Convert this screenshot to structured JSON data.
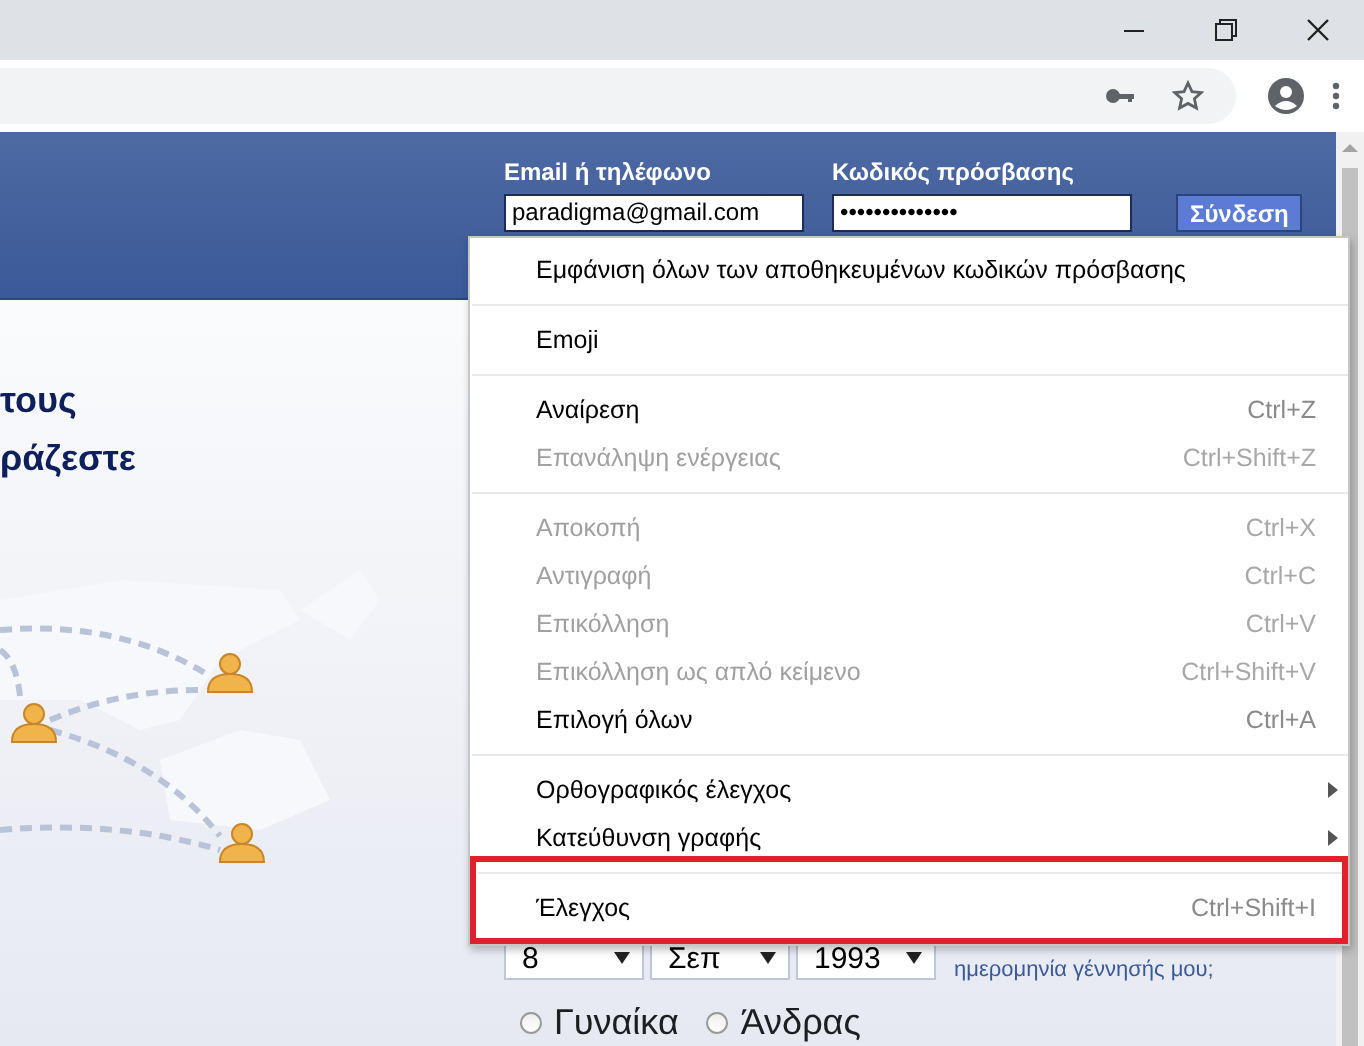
{
  "login": {
    "email_label": "Email ή τηλέφωνο",
    "email_value": "paradigma@gmail.com",
    "password_label": "Κωδικός πρόσβασης",
    "password_mask": "••••••••••••••",
    "button": "Σύνδεση"
  },
  "headline": [
    "τους",
    "ράζεστε"
  ],
  "birthday": {
    "selects": [
      "8",
      "Σεπ",
      "1993"
    ],
    "help": "ημερομηνία γέννησής μου;"
  },
  "gender": [
    {
      "label": "Γυναίκα",
      "selected": false
    },
    {
      "label": "Άνδρας",
      "selected": false
    }
  ],
  "context_menu": {
    "groups": [
      [
        {
          "label": "Εμφάνιση όλων των αποθηκευμένων κωδικών πρόσβασης",
          "disabled": false,
          "submenu": false,
          "highlighted": false
        }
      ],
      [
        {
          "label": "Emoji",
          "disabled": false,
          "submenu": false,
          "highlighted": false
        }
      ],
      [
        {
          "label": "Αναίρεση",
          "shortcut": "Ctrl+Z",
          "disabled": false,
          "submenu": false,
          "highlighted": false
        },
        {
          "label": "Επανάληψη ενέργειας",
          "shortcut": "Ctrl+Shift+Z",
          "disabled": true,
          "submenu": false,
          "highlighted": false
        }
      ],
      [
        {
          "label": "Αποκοπή",
          "shortcut": "Ctrl+X",
          "disabled": true,
          "submenu": false,
          "highlighted": false
        },
        {
          "label": "Αντιγραφή",
          "shortcut": "Ctrl+C",
          "disabled": true,
          "submenu": false,
          "highlighted": false
        },
        {
          "label": "Επικόλληση",
          "shortcut": "Ctrl+V",
          "disabled": true,
          "submenu": false,
          "highlighted": false
        },
        {
          "label": "Επικόλληση ως απλό κείμενο",
          "shortcut": "Ctrl+Shift+V",
          "disabled": true,
          "submenu": false,
          "highlighted": false
        },
        {
          "label": "Επιλογή όλων",
          "shortcut": "Ctrl+A",
          "disabled": false,
          "submenu": false,
          "highlighted": false
        }
      ],
      [
        {
          "label": "Ορθογραφικός έλεγχος",
          "disabled": false,
          "submenu": true,
          "highlighted": false
        },
        {
          "label": "Κατεύθυνση γραφής",
          "disabled": false,
          "submenu": true,
          "highlighted": false
        }
      ],
      [
        {
          "label": "Έλεγχος",
          "shortcut": "Ctrl+Shift+I",
          "disabled": false,
          "submenu": false,
          "highlighted": true
        }
      ]
    ]
  }
}
